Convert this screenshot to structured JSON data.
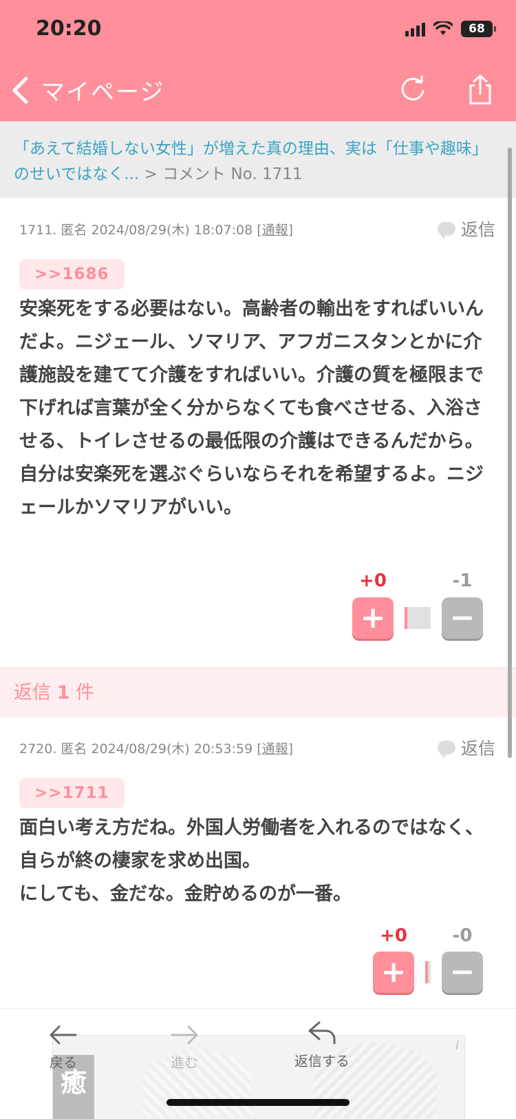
{
  "status": {
    "time": "20:20",
    "battery": "68"
  },
  "nav": {
    "back_label": "マイページ"
  },
  "breadcrumb": {
    "article": "「あえて結婚しない女性」が増えた真の理由、実は「仕事や趣味」のせいではなく...",
    "separator": ">",
    "current": "コメント No. 1711"
  },
  "comments": [
    {
      "meta": "1711. 匿名 2024/08/29(木) 18:07:08 [",
      "report": "通報",
      "meta_end": "]",
      "reply_label": "返信",
      "anchor": ">>1686",
      "body": "安楽死をする必要はない。高齢者の輸出をすればいいんだよ。ニジェール、ソマリア、アフガニスタンとかに介護施設を建てて介護をすればいい。介護の質を極限まで下げれば言葉が全く分からなくても食べさせる、入浴させる、トイレさせるの最低限の介護はできるんだから。自分は安楽死を選ぶぐらいならそれを希望するよ。ニジェールかソマリアがいい。",
      "plus": "+0",
      "minus": "-1",
      "plus_btn": "+",
      "minus_btn": "−"
    },
    {
      "meta": "2720. 匿名 2024/08/29(木) 20:53:59 [",
      "report": "通報",
      "meta_end": "]",
      "reply_label": "返信",
      "anchor": ">>1711",
      "body": "面白い考え方だね。外国人労働者を入れるのではなく、自らが終の棲家を求め出国。\nにしても、金だな。金貯めるのが一番。",
      "plus": "+0",
      "minus": "-0",
      "plus_btn": "+",
      "minus_btn": "−"
    }
  ],
  "replies": {
    "prefix": "返信 ",
    "count": "1",
    "suffix": " 件"
  },
  "toolbar": {
    "back": "戻る",
    "forward": "進む",
    "reply": "返信する"
  },
  "ad": {
    "char": "癒",
    "info": "i"
  },
  "colors": {
    "accent": "#ff8f9a",
    "link": "#3ba3c4",
    "plus": "#e8323c"
  }
}
